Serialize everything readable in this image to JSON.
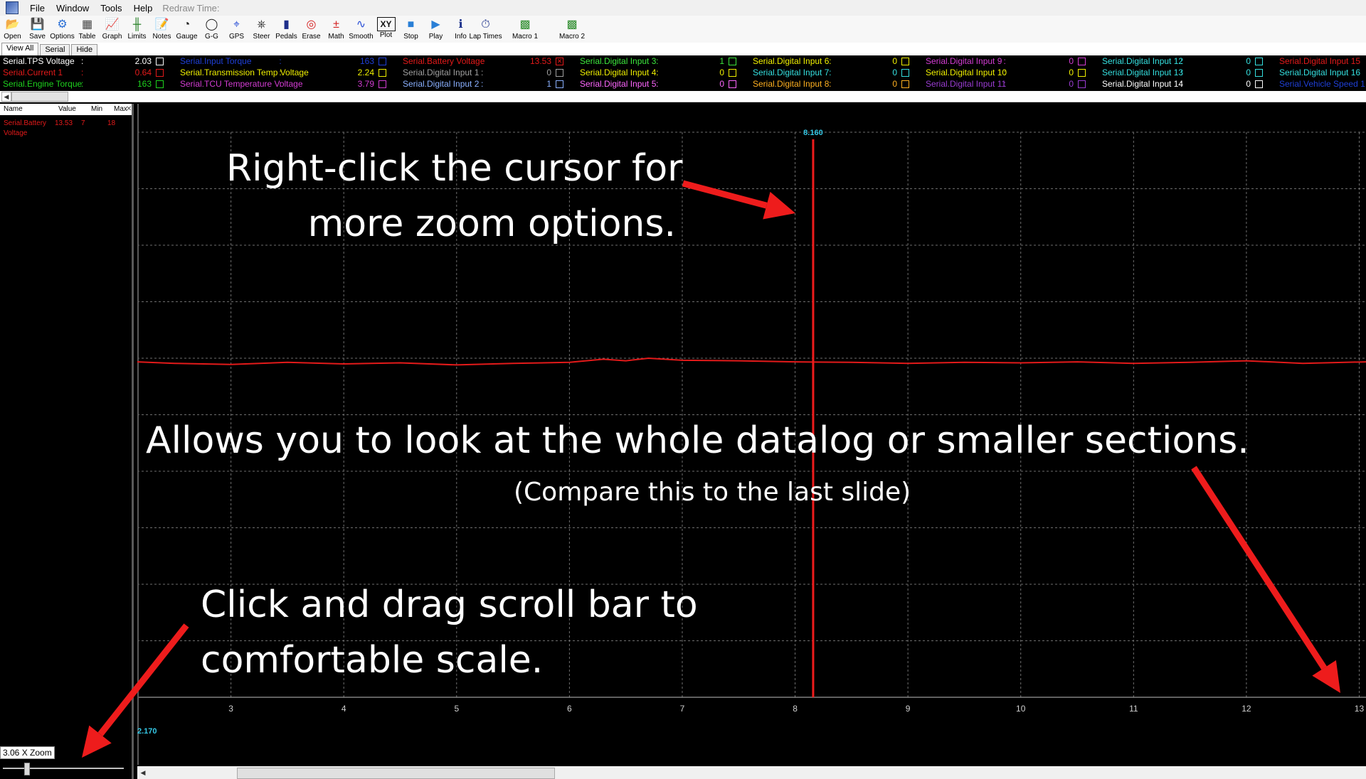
{
  "menu": {
    "items": [
      "File",
      "Window",
      "Tools",
      "Help"
    ],
    "redraw_label": "Redraw Time:"
  },
  "toolbar": {
    "buttons": [
      {
        "label": "Open",
        "icon": "folder-open-icon"
      },
      {
        "label": "Save",
        "icon": "floppy-disk-icon"
      },
      {
        "label": "Options",
        "icon": "options-icon"
      },
      {
        "label": "Table",
        "icon": "table-icon"
      },
      {
        "label": "Graph",
        "icon": "graph-icon"
      },
      {
        "label": "Limits",
        "icon": "limits-icon"
      },
      {
        "label": "Notes",
        "icon": "notes-icon"
      },
      {
        "label": "Gauge",
        "icon": "gauge-icon"
      },
      {
        "label": "G-G",
        "icon": "gg-circle-icon"
      },
      {
        "label": "GPS",
        "icon": "gps-icon"
      },
      {
        "label": "Steer",
        "icon": "steering-wheel-icon"
      },
      {
        "label": "Pedals",
        "icon": "pedals-icon"
      },
      {
        "label": "Erase",
        "icon": "erase-icon"
      },
      {
        "label": "Math",
        "icon": "math-icon"
      },
      {
        "label": "Smooth",
        "icon": "smooth-icon"
      },
      {
        "label": "Plot",
        "icon": "xy-plot-icon"
      },
      {
        "label": "Stop",
        "icon": "stop-icon"
      },
      {
        "label": "Play",
        "icon": "play-icon"
      },
      {
        "label": "Info",
        "icon": "info-icon"
      },
      {
        "label": "Lap Times",
        "icon": "stopwatch-icon"
      },
      {
        "label": "Macro 1",
        "icon": "macro-icon"
      },
      {
        "label": "Macro 2",
        "icon": "macro-icon"
      }
    ]
  },
  "tabs": [
    "View All",
    "Serial",
    "Hide"
  ],
  "channels": [
    [
      {
        "name": "Serial.TPS Voltage",
        "value": "2.03",
        "color": "#ffffff",
        "checked": false
      },
      {
        "name": "Serial.Current 1",
        "value": "0.64",
        "color": "#e31a1a",
        "checked": false
      },
      {
        "name": "Serial.Engine Torque",
        "value": "163",
        "color": "#1ed21e",
        "checked": false
      }
    ],
    [
      {
        "name": "Serial.Input Torque",
        "value": "163",
        "color": "#1f3fd6",
        "checked": false
      },
      {
        "name": "Serial.Transmission Temp Voltage",
        "value": "2.24",
        "color": "#f0f000",
        "checked": false
      },
      {
        "name": "Serial.TCU Temperature Voltage",
        "value": "3.79",
        "color": "#d23cd2",
        "checked": false
      }
    ],
    [
      {
        "name": "Serial.Battery Voltage",
        "value": "13.53",
        "color": "#e31a1a",
        "checked": true
      },
      {
        "name": "Serial.Digital Input 1",
        "value": "0",
        "color": "#a0a0a0",
        "checked": false
      },
      {
        "name": "Serial.Digital Input 2",
        "value": "1",
        "color": "#8ab0ff",
        "checked": false
      }
    ],
    [
      {
        "name": "Serial.Digital Input 3",
        "value": "1",
        "color": "#3ce63c",
        "checked": false
      },
      {
        "name": "Serial.Digital Input 4",
        "value": "0",
        "color": "#f0f000",
        "checked": false
      },
      {
        "name": "Serial.Digital Input 5",
        "value": "0",
        "color": "#ff66ff",
        "checked": false
      }
    ],
    [
      {
        "name": "Serial.Digital Input 6",
        "value": "0",
        "color": "#f0f000",
        "checked": false
      },
      {
        "name": "Serial.Digital Input 7",
        "value": "0",
        "color": "#35e0e0",
        "checked": false
      },
      {
        "name": "Serial.Digital Input 8",
        "value": "0",
        "color": "#ffb020",
        "checked": false
      }
    ],
    [
      {
        "name": "Serial.Digital Input 9",
        "value": "0",
        "color": "#d23cd2",
        "checked": false
      },
      {
        "name": "Serial.Digital Input 10",
        "value": "0",
        "color": "#f0f000",
        "checked": false
      },
      {
        "name": "Serial.Digital Input 11",
        "value": "0",
        "color": "#9a3cd2",
        "checked": false
      }
    ],
    [
      {
        "name": "Serial.Digital Input 12",
        "value": "0",
        "color": "#35e0e0",
        "checked": false
      },
      {
        "name": "Serial.Digital Input 13",
        "value": "0",
        "color": "#35e0e0",
        "checked": false
      },
      {
        "name": "Serial.Digital Input 14",
        "value": "0",
        "color": "#ffffff",
        "checked": false
      }
    ],
    [
      {
        "name": "Serial.Digital Input 15",
        "value": "",
        "color": "#e31a1a",
        "checked": false
      },
      {
        "name": "Serial.Digital Input 16",
        "value": "",
        "color": "#35e0e0",
        "checked": false
      },
      {
        "name": "Serial.Vehicle Speed 1",
        "value": "",
        "color": "#1f3fd6",
        "checked": false
      }
    ]
  ],
  "side": {
    "headers": {
      "name": "Name",
      "value": "Value",
      "min": "Min",
      "max": "Max"
    },
    "row": {
      "name_line1": "Serial.Battery",
      "name_line2": "Voltage",
      "value": "13.53",
      "min": "7",
      "max": "18",
      "color": "#e31a1a"
    },
    "zoom_label": "3.06 X Zoom"
  },
  "plot": {
    "cursor_label": "8.160",
    "left_label": "2.170",
    "accent_cyan": "#35c8e6",
    "trace_color": "#e31a1a"
  },
  "chart_data": {
    "type": "line",
    "title": "",
    "xlabel": "",
    "ylabel": "",
    "x_ticks": [
      3,
      4,
      5,
      6,
      7,
      8,
      9,
      10,
      11,
      12,
      13
    ],
    "xlim": [
      2.17,
      13.06
    ],
    "ylim": [
      7,
      18
    ],
    "cursor_x": 8.16,
    "series": [
      {
        "name": "Serial.Battery Voltage",
        "color": "#e31a1a",
        "x": [
          2.17,
          2.5,
          3.0,
          3.5,
          4.0,
          4.5,
          5.0,
          5.5,
          6.0,
          6.3,
          6.5,
          6.7,
          7.0,
          7.5,
          8.0,
          8.5,
          9.0,
          9.5,
          10.0,
          10.5,
          11.0,
          11.5,
          12.0,
          12.5,
          13.06
        ],
        "y": [
          13.53,
          13.5,
          13.48,
          13.52,
          13.49,
          13.51,
          13.47,
          13.5,
          13.52,
          13.58,
          13.55,
          13.6,
          13.56,
          13.55,
          13.53,
          13.52,
          13.5,
          13.52,
          13.51,
          13.53,
          13.5,
          13.52,
          13.55,
          13.5,
          13.53
        ]
      }
    ]
  },
  "annotations": {
    "cursor_note_line1": "Right-click the cursor for",
    "cursor_note_line2": "more zoom options.",
    "whole_log": "Allows you to look at the whole datalog or smaller sections.",
    "compare": "(Compare this to the last slide)",
    "drag_line1": "Click and drag scroll bar to",
    "drag_line2": "comfortable scale.",
    "arrow_color": "#ee1c1c"
  }
}
